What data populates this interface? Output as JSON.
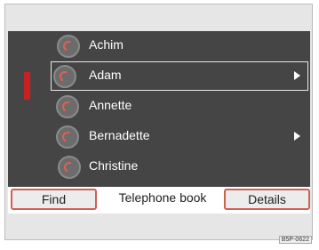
{
  "contacts": [
    {
      "name": "Achim",
      "selected": false,
      "has_arrow": false
    },
    {
      "name": "Adam",
      "selected": true,
      "has_arrow": true
    },
    {
      "name": "Annette",
      "selected": false,
      "has_arrow": false
    },
    {
      "name": "Bernadette",
      "selected": false,
      "has_arrow": true
    },
    {
      "name": "Christine",
      "selected": false,
      "has_arrow": false
    }
  ],
  "bottom_bar": {
    "find_label": "Find",
    "title": "Telephone book",
    "details_label": "Details"
  },
  "stamp": "B5P-0622",
  "colors": {
    "screen_bg": "#454545",
    "accent": "#d06050",
    "scroll_marker": "#cc2020"
  }
}
